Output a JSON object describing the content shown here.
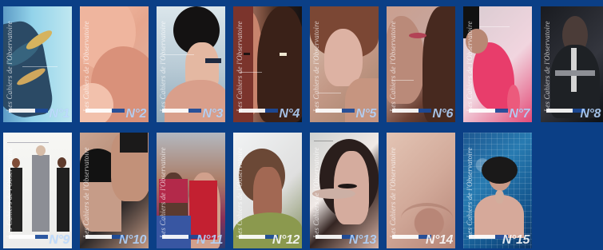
{
  "covers": [
    {
      "title": "Les Cahiers de l'Observatoire",
      "issue": "N°1",
      "icon": "tattooed-back-cover-art"
    },
    {
      "title": "Les Cahiers de l'Observatoire",
      "issue": "N°2",
      "icon": "neck-and-shoulder-cover-art"
    },
    {
      "title": "Les Cahiers de l'Observatoire",
      "issue": "N°3",
      "icon": "back-of-head-cover-art"
    },
    {
      "title": "Les Cahiers de l'Observatoire",
      "issue": "N°4",
      "icon": "two-faces-cover-art"
    },
    {
      "title": "Les Cahiers de l'Observatoire",
      "issue": "N°5",
      "icon": "profile-face-cover-art"
    },
    {
      "title": "Les Cahiers de l'Observatoire",
      "issue": "N°6",
      "icon": "two-faces-profile-cover-art"
    },
    {
      "title": "Les Cahiers de l'Observatoire",
      "issue": "N°7",
      "icon": "pink-fabric-figure-cover-art"
    },
    {
      "title": "Les Cahiers de l'Observatoire",
      "issue": "N°8",
      "icon": "dark-costume-figure-cover-art"
    },
    {
      "title": "Les Cahiers de l'Observatoire",
      "issue": "N°9",
      "icon": "three-people-cover-art"
    },
    {
      "title": "Les Cahiers de l'Observatoire",
      "issue": "N°10",
      "icon": "couple-close-up-cover-art"
    },
    {
      "title": "Les Cahiers de l'Observatoire",
      "issue": "N°11",
      "icon": "two-women-cover-art"
    },
    {
      "title": "Les Cahiers de l'Observatoire",
      "issue": "N°12",
      "icon": "hair-profile-cover-art"
    },
    {
      "title": "Les Cahiers de l'Observatoire",
      "issue": "N°13",
      "icon": "hand-mustache-cover-art"
    },
    {
      "title": "Les Cahiers de l'Observatoire",
      "issue": "N°14",
      "icon": "skin-texture-cover-art"
    },
    {
      "title": "Les Cahiers de l'Observatoire",
      "issue": "N°15",
      "icon": "bathing-woman-cover-art"
    }
  ],
  "colors": {
    "background": "#0b3f86",
    "issue_number": "#b4d6ff",
    "brand_blue": "#1b4b9b"
  }
}
